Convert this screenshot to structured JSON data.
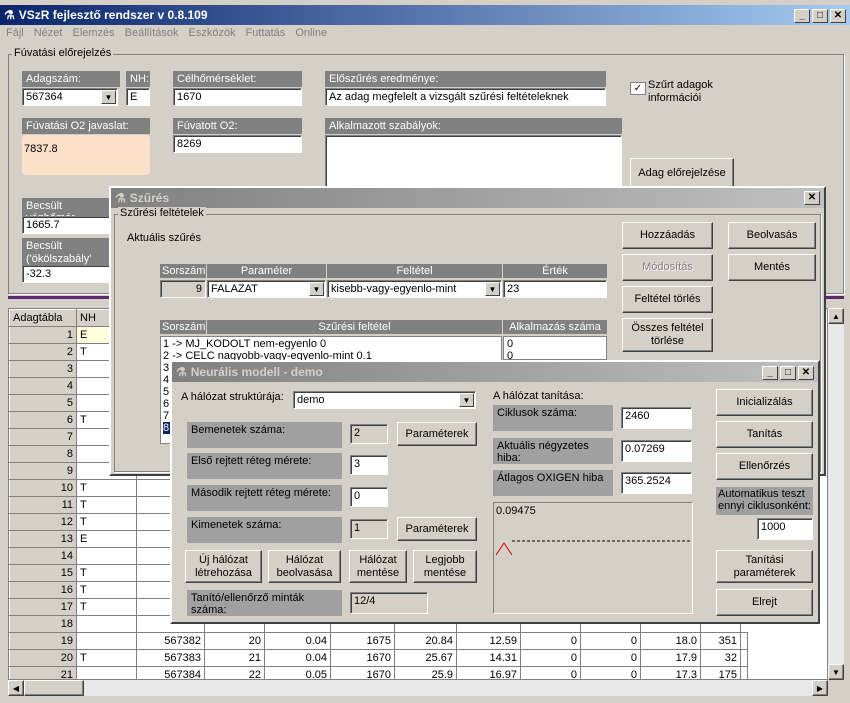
{
  "app": {
    "title": "VSzR fejlesztő rendszer   v 0.8.109",
    "menu": [
      "Fájl",
      "Nézet",
      "Elemzés",
      "Beállítások",
      "Eszközök",
      "Futtatás",
      "Online"
    ]
  },
  "forecast": {
    "group_label": "Fúvatási előrejelzés",
    "adagszam_label": "Adagszám:",
    "adagszam_value": "567364",
    "nh_label": "NH:",
    "nh_value": "E",
    "celhom_label": "Célhőmérséklet:",
    "celhom_value": "1670",
    "elo_label": "Előszűrés eredménye:",
    "elo_value": "Az adag megfelelt a vizsgált szűrési feltételeknek",
    "szurt_label": "Szűrt adagok információi",
    "szurt_checked": true,
    "o2_javaslat_label": "Fúvatási O2 javaslat:",
    "o2_javaslat_value": "7837.8",
    "fuvatott_label": "Fúvatott O2:",
    "fuvatott_value": "8269",
    "szabalyok_label": "Alkalmazott szabályok:",
    "elorejelzes_button": "Adag előrejelzése",
    "becsult_veg_label": "Becsült véghőmér",
    "becsult_veg_value": "1665.7",
    "becsult_hom_label": "Becsült hőmérsékl",
    "okol_label": "('ökölszabály' szeri",
    "okol_value": "-32.3"
  },
  "table": {
    "header": "Adagtábla",
    "nh_header": "NH",
    "rows": [
      {
        "n": "1",
        "nh": "E"
      },
      {
        "n": "2",
        "nh": "T"
      },
      {
        "n": "3",
        "nh": ""
      },
      {
        "n": "4",
        "nh": ""
      },
      {
        "n": "5",
        "nh": ""
      },
      {
        "n": "6",
        "nh": "T"
      },
      {
        "n": "7",
        "nh": ""
      },
      {
        "n": "8",
        "nh": ""
      },
      {
        "n": "9",
        "nh": ""
      },
      {
        "n": "10",
        "nh": "T"
      },
      {
        "n": "11",
        "nh": "T"
      },
      {
        "n": "12",
        "nh": "T"
      },
      {
        "n": "13",
        "nh": "E"
      },
      {
        "n": "14",
        "nh": ""
      },
      {
        "n": "15",
        "nh": "T"
      },
      {
        "n": "16",
        "nh": "T"
      },
      {
        "n": "17",
        "nh": "T"
      },
      {
        "n": "18",
        "nh": ""
      }
    ],
    "full_rows": [
      {
        "n": "19",
        "nh": "",
        "a": "567382",
        "b": "20",
        "c": "0.04",
        "d": "1675",
        "e": "20.84",
        "f": "12.59",
        "g": "0",
        "h": "0",
        "i": "18.0",
        "j": "351"
      },
      {
        "n": "20",
        "nh": "T",
        "a": "567383",
        "b": "21",
        "c": "0.04",
        "d": "1670",
        "e": "25.67",
        "f": "14.31",
        "g": "0",
        "h": "0",
        "i": "17.9",
        "j": "32"
      },
      {
        "n": "21",
        "nh": "",
        "a": "567384",
        "b": "22",
        "c": "0.05",
        "d": "1670",
        "e": "25.9",
        "f": "16.97",
        "g": "0",
        "h": "0",
        "i": "17.3",
        "j": "175"
      }
    ]
  },
  "szures": {
    "title": "Szűrés",
    "group_label": "Szűrési feltételek",
    "aktualis_label": "Aktuális szűrés",
    "col_sorszam": "Sorszám",
    "col_parameter": "Paraméter",
    "col_feltetel": "Feltétel",
    "col_ertek": "Érték",
    "sorszam_value": "9",
    "parameter_value": "FALAZAT",
    "feltetel_value": "kisebb-vagy-egyenlo-mint",
    "ertek_value": "23",
    "list_col_sorszam": "Sorszám",
    "list_col_feltetel": "Szűrési feltétel",
    "list_col_alk": "Alkalmazás száma",
    "list_items": [
      {
        "row": "1 ->   MJ_KODOLT  nem-egyenlo  0",
        "alk": "0"
      },
      {
        "row": "2 ->   CELC  nagyobb-vagy-egyenlo-mint  0.1",
        "alk": "0"
      }
    ],
    "list_numbers": [
      "3",
      "4",
      "5",
      "6",
      "7",
      "8"
    ],
    "hozzaadas": "Hozzáadás",
    "beolvasas": "Beolvasás",
    "modositas": "Módosítás",
    "mentes": "Mentés",
    "feltetel_torles": "Feltétel törlés",
    "osszes_torles": "Összes feltétel törlése"
  },
  "neural": {
    "title": "Neurális modell - demo",
    "struktura_label": "A hálózat struktúrája:",
    "struktura_value": "demo",
    "bemenetek_label": "Bemenetek száma:",
    "bemenetek_value": "2",
    "parameterek_btn": "Paraméterek",
    "elso_label": "Első rejtett réteg mérete:",
    "elso_value": "3",
    "masodik_label": "Második rejtett réteg mérete:",
    "masodik_value": "0",
    "kimenetek_label": "Kimenetek száma:",
    "kimenetek_value": "1",
    "uj_btn": "Új hálózat létrehozása",
    "beolvas_btn": "Hálózat beolvasása",
    "ment_btn": "Hálózat mentése",
    "legjobb_btn": "Legjobb mentése",
    "minta_label": "Tanító/ellenőrző minták száma:",
    "minta_value": "12/4",
    "tanitas_label": "A hálózat tanítása:",
    "ciklus_label": "Ciklusok száma:",
    "ciklus_value": "2460",
    "hiba_label": "Aktuális négyzetes hiba:",
    "hiba_value": "0.07269",
    "oxigen_label": "Átlagos OXIGEN hiba",
    "oxigen_value": "365.2524",
    "graph_value": "0.09475",
    "inicializalas": "Inicializálás",
    "tanitas": "Tanítás",
    "ellenorzes": "Ellenőrzés",
    "auto_label": "Automatikus teszt ennyi ciklusonként:",
    "auto_value": "1000",
    "tanitasi_param": "Tanítási paraméterek",
    "elrejt": "Elrejt"
  }
}
